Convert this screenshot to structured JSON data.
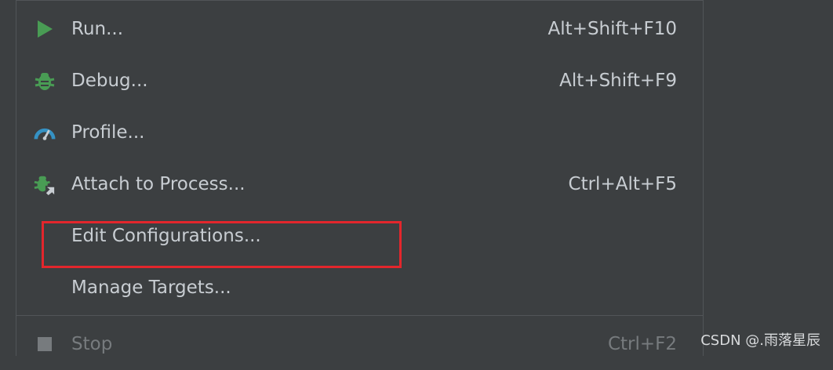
{
  "menu": {
    "items": [
      {
        "label": "Run...",
        "shortcut": "Alt+Shift+F10",
        "icon": "run-icon"
      },
      {
        "label": "Debug...",
        "shortcut": "Alt+Shift+F9",
        "icon": "debug-icon"
      },
      {
        "label": "Profile...",
        "shortcut": "",
        "icon": "profile-icon"
      },
      {
        "label": "Attach to Process...",
        "shortcut": "Ctrl+Alt+F5",
        "icon": "attach-process-icon"
      },
      {
        "label": "Edit Configurations...",
        "shortcut": "",
        "icon": ""
      },
      {
        "label": "Manage Targets...",
        "shortcut": "",
        "icon": ""
      },
      {
        "label": "Stop",
        "shortcut": "Ctrl+F2",
        "icon": "stop-icon",
        "disabled": true
      }
    ]
  },
  "watermark": "CSDN @.雨落星辰",
  "colors": {
    "background": "#3c3f41",
    "text": "#c8cdd2",
    "disabled_text": "#777b7e",
    "run_green": "#499c54",
    "profile_blue": "#3592c4",
    "highlight_red": "#e3262c"
  }
}
